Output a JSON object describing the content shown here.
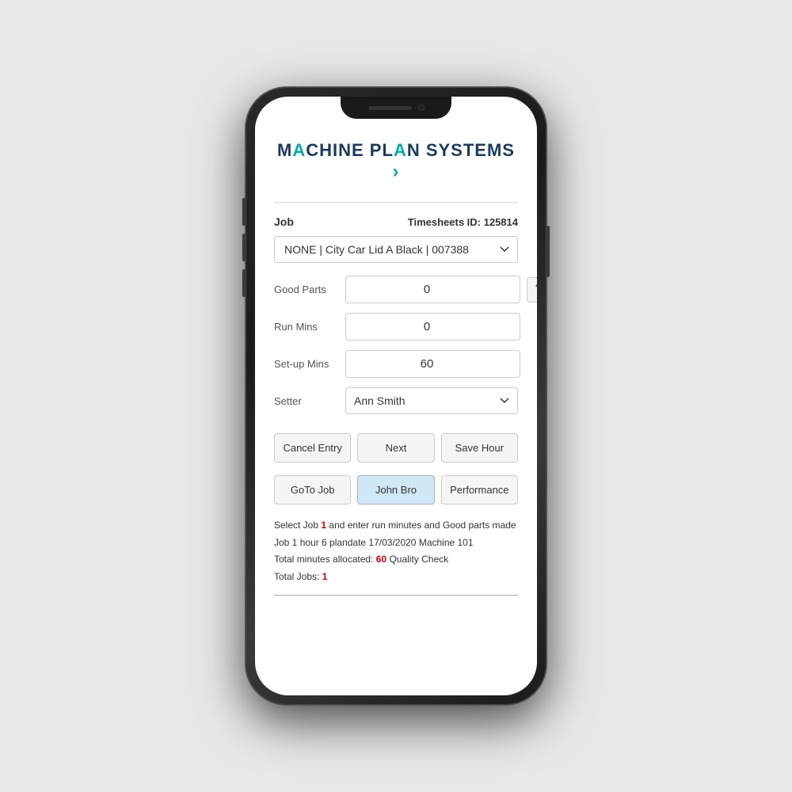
{
  "app": {
    "logo": {
      "part1": "M",
      "part2_accent": "A",
      "part3": "CHINE PL",
      "part4_accent": "A",
      "part5": "N SYSTEMS",
      "chevron": "›"
    }
  },
  "header": {
    "job_label": "Job",
    "timesheets_label": "Timesheets ID: 125814"
  },
  "job_dropdown": {
    "value": "NONE | City Car Lid A Black | 007388"
  },
  "form": {
    "good_parts_label": "Good Parts",
    "good_parts_value": "0",
    "run_mins_label": "Run Mins",
    "run_mins_value": "0",
    "setup_mins_label": "Set-up Mins",
    "setup_mins_value": "60",
    "setter_label": "Setter",
    "setter_value": "Ann Smith",
    "help_button": "?"
  },
  "action_buttons": {
    "cancel": "Cancel Entry",
    "next": "Next",
    "save_hour": "Save Hour"
  },
  "nav_buttons": {
    "goto_job": "GoTo Job",
    "user": "John Bro",
    "performance": "Performance"
  },
  "info": {
    "line1_pre": "Select Job ",
    "line1_num": "1",
    "line1_post": " and enter run minutes and Good parts made",
    "line2": "Job 1 hour 6 plandate 17/03/2020 Machine 101",
    "line3_pre": "Total minutes allocated: ",
    "line3_num": "60",
    "line3_post": "        Quality Check",
    "line4_pre": "Total Jobs: ",
    "line4_num": "1"
  }
}
